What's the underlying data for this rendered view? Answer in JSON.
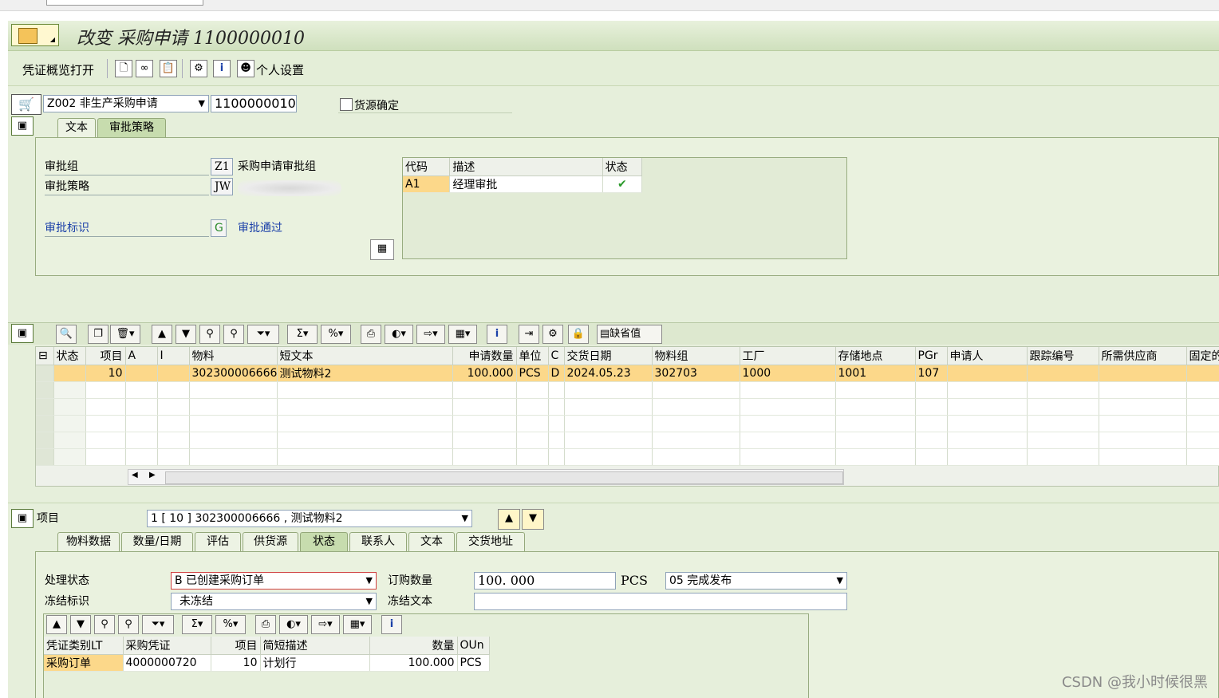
{
  "window": {
    "title": "改变 采购申请 1100000010"
  },
  "toolbar": {
    "doc_overview_label": "凭证概览打开",
    "personal_settings_label": "个人设置",
    "icons": [
      "new-doc-icon",
      "glasses-icon",
      "clipboard-icon",
      "org-icon",
      "info-icon",
      "person-settings-icon"
    ]
  },
  "header": {
    "doc_type": "Z002 非生产采购申请",
    "doc_number": "1100000010",
    "source_determination_label": "货源确定",
    "source_determination_checked": false
  },
  "header_tabs": [
    {
      "label": "文本",
      "active": false
    },
    {
      "label": "审批策略",
      "active": true
    }
  ],
  "approval": {
    "group_label": "审批组",
    "group_code": "Z1",
    "group_desc": "采购申请审批组",
    "strategy_label": "审批策略",
    "strategy_code": "JW",
    "indicator_label": "审批标识",
    "indicator_code": "G",
    "indicator_desc": "审批通过",
    "table_headers": [
      "代码",
      "描述",
      "状态"
    ],
    "table_rows": [
      {
        "code": "A1",
        "desc": "经理审批",
        "status": "✔"
      }
    ]
  },
  "item_toolbar": {
    "default_values_label": "缺省值"
  },
  "item_grid": {
    "headers": [
      "状态",
      "项目",
      "A",
      "I",
      "物料",
      "短文本",
      "申请数量",
      "单位",
      "C",
      "交货日期",
      "物料组",
      "工厂",
      "存储地点",
      "PGr",
      "申请人",
      "跟踪编号",
      "所需供应商",
      "固定的"
    ],
    "rows": [
      {
        "status": "",
        "item": "10",
        "a": "",
        "i": "",
        "material": "302300006666",
        "short_text": "测试物料2",
        "qty": "100.000",
        "unit": "PCS",
        "c": "D",
        "delivery_date": "2024.05.23",
        "mat_group": "302703",
        "plant": "1000",
        "storage": "1001",
        "pgr": "107",
        "requester": "",
        "tracking": "",
        "vendor": "",
        "fixed": ""
      }
    ]
  },
  "item_detail": {
    "label": "项目",
    "selected_item": "1 [ 10 ] 302300006666 , 测试物料2"
  },
  "detail_tabs": [
    {
      "label": "物料数据",
      "active": false
    },
    {
      "label": "数量/日期",
      "active": false
    },
    {
      "label": "评估",
      "active": false
    },
    {
      "label": "供货源",
      "active": false
    },
    {
      "label": "状态",
      "active": true
    },
    {
      "label": "联系人",
      "active": false
    },
    {
      "label": "文本",
      "active": false
    },
    {
      "label": "交货地址",
      "active": false
    }
  ],
  "status_tab": {
    "processing_status_label": "处理状态",
    "processing_status_value": "B 已创建采购订单",
    "order_qty_label": "订购数量",
    "order_qty_value": "100. 000",
    "order_qty_unit": "PCS",
    "release_status_value": "05 完成发布",
    "blocking_label": "冻结标识",
    "blocking_value": "未冻结",
    "blocking_text_label": "冻结文本",
    "blocking_text_value": "",
    "po_grid_headers": [
      "凭证类别LT",
      "采购凭证",
      "项目",
      "简短描述",
      "数量",
      "OUn"
    ],
    "po_grid_rows": [
      {
        "cat": "采购订单",
        "po": "4000000720",
        "item": "10",
        "desc": "计划行",
        "qty": "100.000",
        "unit": "PCS"
      }
    ]
  },
  "watermark": "CSDN @我小时候很黑"
}
